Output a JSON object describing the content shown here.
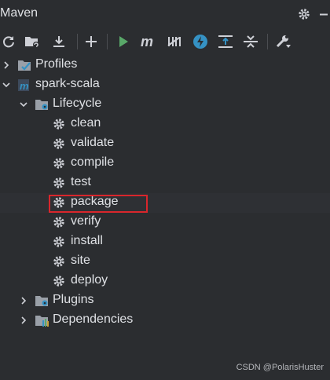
{
  "panel": {
    "title": "Maven"
  },
  "tree": {
    "profiles": "Profiles",
    "project": "spark-scala",
    "lifecycle": "Lifecycle",
    "goals": [
      "clean",
      "validate",
      "compile",
      "test",
      "package",
      "verify",
      "install",
      "site",
      "deploy"
    ],
    "plugins": "Plugins",
    "dependencies": "Dependencies"
  },
  "selected_goal": "package",
  "colors": {
    "background": "#2b2d30",
    "text": "#dfe1e5",
    "run_green": "#59a869",
    "accent_blue": "#3592c4",
    "highlight_red": "#d9262c"
  },
  "watermark": "CSDN @PolarisHuster"
}
